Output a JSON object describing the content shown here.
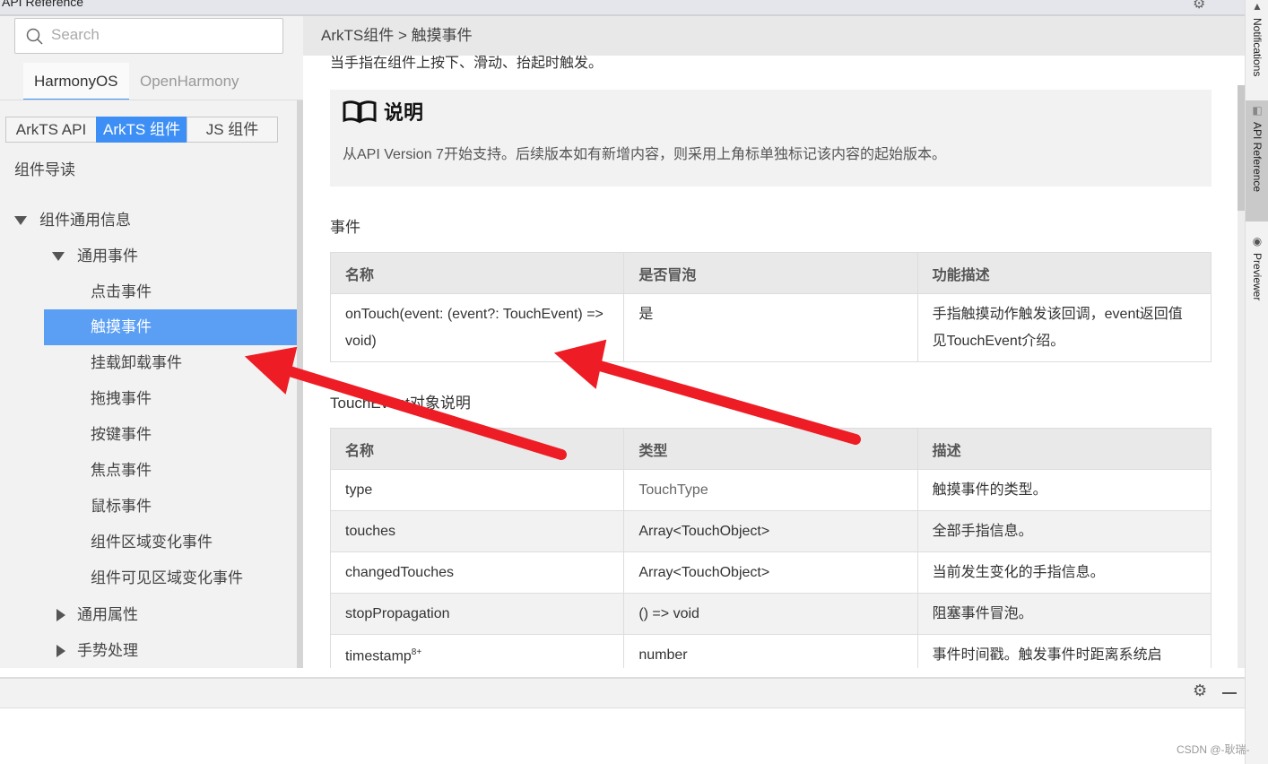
{
  "window": {
    "title": "API Reference"
  },
  "right_tabs": [
    {
      "label": "Notifications",
      "icon": "bell-icon"
    },
    {
      "label": "API Reference",
      "icon": "api-icon"
    },
    {
      "label": "Previewer",
      "icon": "eye-icon"
    }
  ],
  "sidebar": {
    "search_placeholder": "Search",
    "os_tabs": [
      {
        "label": "HarmonyOS",
        "active": true
      },
      {
        "label": "OpenHarmony",
        "active": false
      }
    ],
    "api_tabs": [
      {
        "label": "ArkTS API",
        "active": false
      },
      {
        "label": "ArkTS 组件",
        "active": true
      },
      {
        "label": "JS 组件",
        "active": false
      }
    ],
    "tree": [
      {
        "label": "组件导读"
      },
      {
        "label": "组件通用信息",
        "expanded": true
      },
      {
        "label": "通用事件",
        "expanded": true
      },
      {
        "label": "点击事件"
      },
      {
        "label": "触摸事件",
        "selected": true
      },
      {
        "label": "挂载卸载事件"
      },
      {
        "label": "拖拽事件"
      },
      {
        "label": "按键事件"
      },
      {
        "label": "焦点事件"
      },
      {
        "label": "鼠标事件"
      },
      {
        "label": "组件区域变化事件"
      },
      {
        "label": "组件可见区域变化事件"
      },
      {
        "label": "通用属性",
        "expanded": false
      },
      {
        "label": "手势处理",
        "expanded": false
      }
    ]
  },
  "breadcrumb": "ArkTS组件 > 触摸事件",
  "content": {
    "intro": "当手指在组件上按下、滑动、抬起时触发。",
    "note_title": "说明",
    "note_text": "从API Version 7开始支持。后续版本如有新增内容，则采用上角标单独标记该内容的起始版本。",
    "events_heading": "事件",
    "events_table": {
      "headers": [
        "名称",
        "是否冒泡",
        "功能描述"
      ],
      "rows": [
        [
          "onTouch(event: (event?: TouchEvent) => void)",
          "是",
          "手指触摸动作触发该回调，event返回值见TouchEvent介绍。"
        ]
      ]
    },
    "touchevent_heading": "TouchEvent对象说明",
    "touchevent_table": {
      "headers": [
        "名称",
        "类型",
        "描述"
      ],
      "rows": [
        [
          "type",
          "TouchType",
          "触摸事件的类型。"
        ],
        [
          "touches",
          "Array<TouchObject>",
          "全部手指信息。"
        ],
        [
          "changedTouches",
          "Array<TouchObject>",
          "当前发生变化的手指信息。"
        ],
        [
          "stopPropagation",
          "() => void",
          "阻塞事件冒泡。"
        ],
        [
          "timestamp",
          "number",
          "事件时间戳。触发事件时距离系统启"
        ]
      ],
      "timestamp_sup": "8+"
    }
  },
  "watermark": "CSDN @-耿瑞-",
  "colors": {
    "accent": "#3d8ff5",
    "selected": "#5b9ff5",
    "annotation_arrow": "#ee1c24"
  }
}
